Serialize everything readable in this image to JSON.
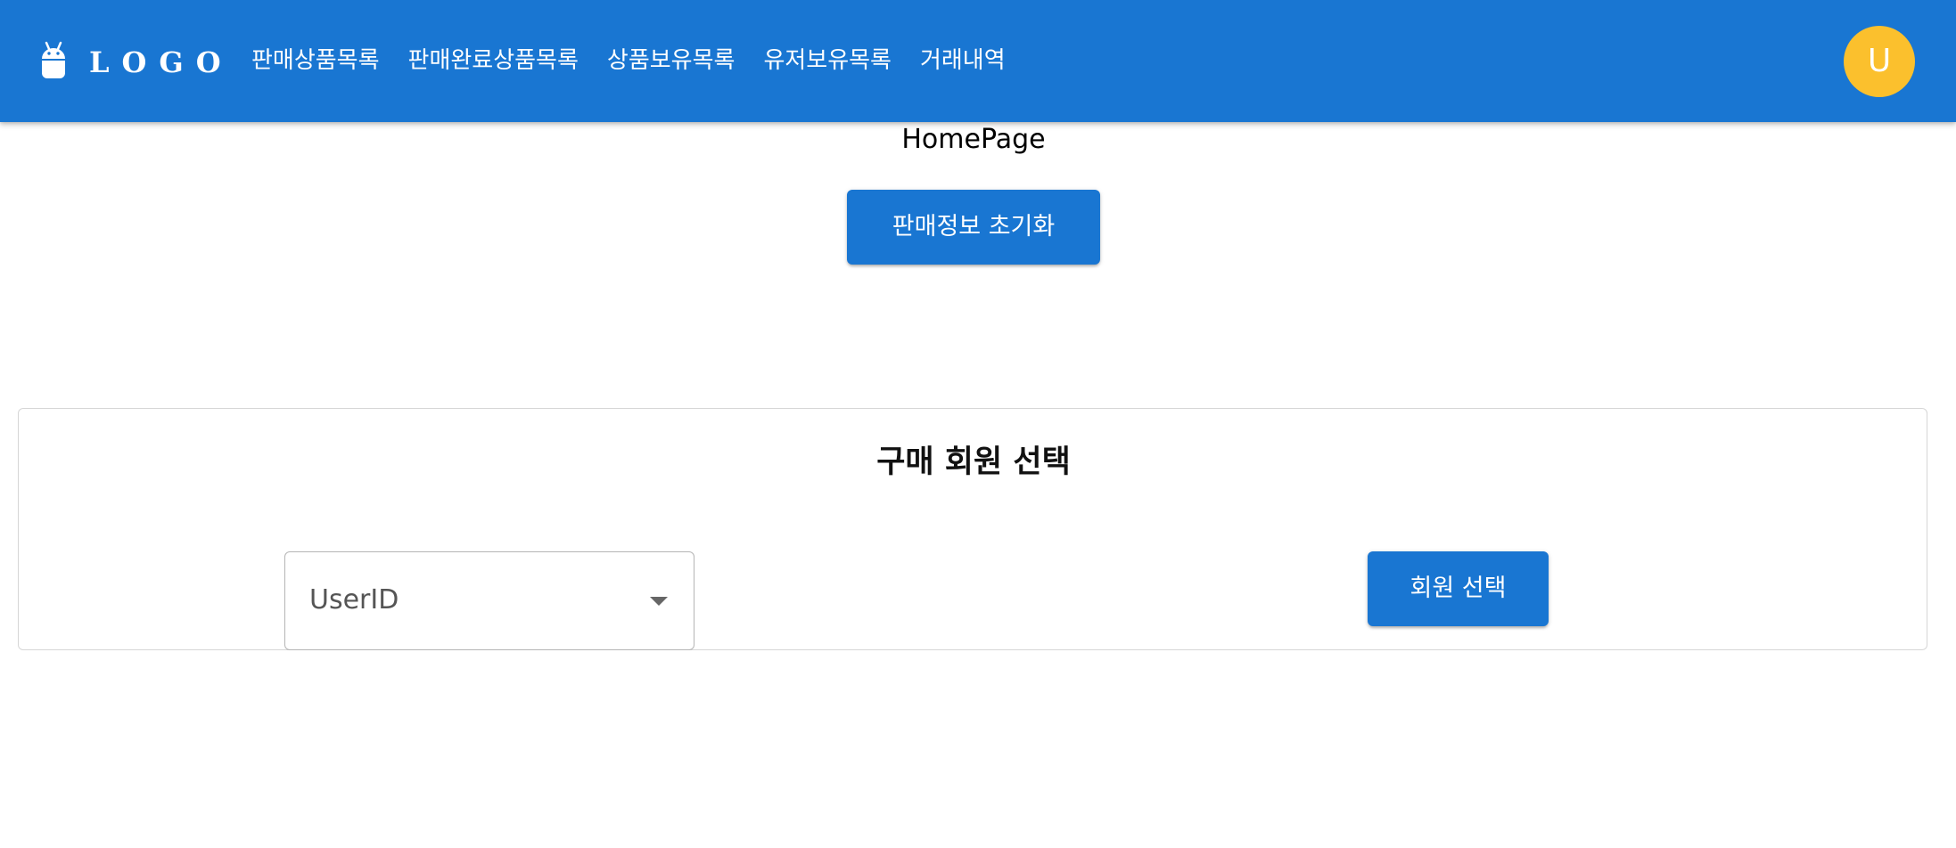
{
  "header": {
    "logo_text": "LOGO",
    "logo_icon": "android-icon",
    "nav_items": [
      {
        "label": "판매상품목록"
      },
      {
        "label": "판매완료상품목록"
      },
      {
        "label": "상품보유목록"
      },
      {
        "label": "유저보유목록"
      },
      {
        "label": "거래내역"
      }
    ],
    "avatar_initial": "U",
    "colors": {
      "appbar": "#1976d2",
      "avatar": "#fbc02d"
    }
  },
  "main": {
    "heading": "HomePage",
    "reset_button": "판매정보 초기화"
  },
  "member_card": {
    "title": "구매 회원 선택",
    "select": {
      "label": "UserID",
      "icon": "chevron-down-icon"
    },
    "select_button": "회원 선택"
  }
}
